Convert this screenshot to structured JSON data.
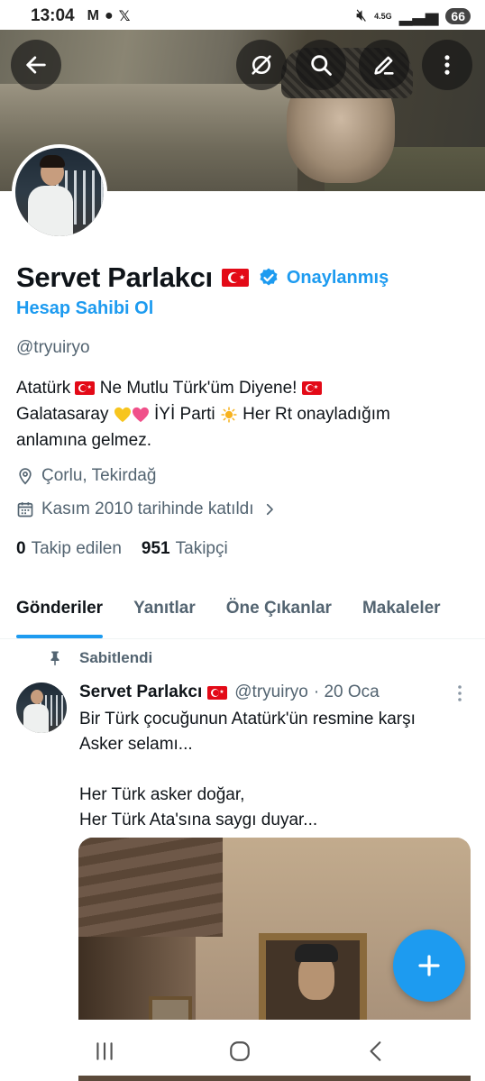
{
  "status_bar": {
    "time": "13:04",
    "left_icons": [
      "gmail-icon",
      "chat-bubble-icon",
      "x-logo-icon"
    ],
    "network_label_top": "4.5G",
    "battery": "66"
  },
  "banner": {
    "back_icon": "arrow-left-icon",
    "actions": [
      "grok-icon",
      "search-icon",
      "edit-icon",
      "more-vertical-icon"
    ]
  },
  "profile": {
    "name": "Servet Parlakcı",
    "verified_label": "Onaylanmış",
    "claim_link": "Hesap Sahibi Ol",
    "handle": "@tryuiryo",
    "bio": {
      "line1_a": "Atatürk",
      "line1_b": "Ne Mutlu Türk'üm Diyene!",
      "line2_a": "Galatasaray",
      "line2_b": "İYİ Parti",
      "line2_c": "Her Rt onayladığım",
      "line3": "anlamına gelmez."
    },
    "location": "Çorlu, Tekirdağ",
    "joined": "Kasım 2010 tarihinde katıldı",
    "following_count": "0",
    "following_label": "Takip edilen",
    "followers_count": "951",
    "followers_label": "Takipçi"
  },
  "tabs": [
    {
      "label": "Gönderiler",
      "active": true
    },
    {
      "label": "Yanıtlar",
      "active": false
    },
    {
      "label": "Öne Çıkanlar",
      "active": false
    },
    {
      "label": "Makaleler",
      "active": false
    }
  ],
  "pinned_post": {
    "pinned_label": "Sabitlendi",
    "author": "Servet Parlakcı",
    "handle": "@tryuiryo",
    "date": "· 20 Oca",
    "text_lines": [
      "Bir Türk çocuğunun Atatürk'ün resmine karşı",
      "Asker selamı...",
      "",
      "Her Türk asker doğar,",
      "Her Türk Ata'sına saygı duyar..."
    ]
  },
  "fab": {
    "icon": "plus-icon"
  },
  "nav": [
    "recents-icon",
    "home-icon",
    "back-nav-icon"
  ],
  "colors": {
    "accent": "#1d9bf0",
    "text": "#0f1419",
    "muted": "#536471",
    "flag_red": "#e30a17"
  }
}
